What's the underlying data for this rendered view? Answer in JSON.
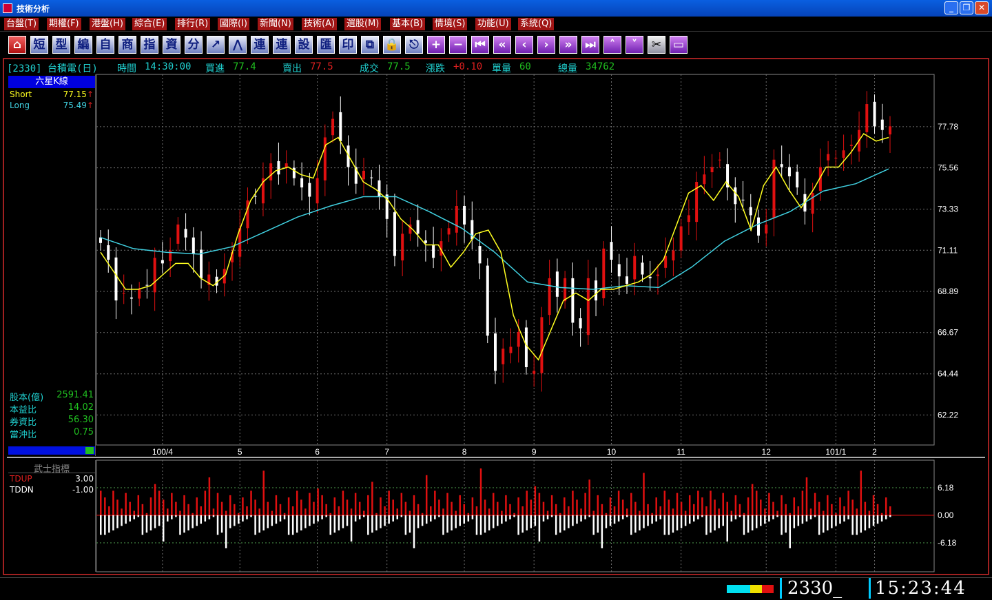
{
  "window": {
    "title": "技術分析",
    "min": "_",
    "restore": "❐",
    "close": "✕"
  },
  "menu": [
    "台盤(T)",
    "期權(F)",
    "港盤(H)",
    "綜合(E)",
    "排行(R)",
    "國際(I)",
    "新聞(N)",
    "技術(A)",
    "選股(M)",
    "基本(B)",
    "情境(S)",
    "功能(U)",
    "系統(Q)"
  ],
  "toolbar": [
    {
      "icon": "home-icon",
      "glyph": "⌂",
      "style": "red"
    },
    {
      "icon": "short-icon",
      "glyph": "短"
    },
    {
      "icon": "type-icon",
      "glyph": "型"
    },
    {
      "icon": "edit-icon",
      "glyph": "編"
    },
    {
      "icon": "custom-icon",
      "glyph": "自"
    },
    {
      "icon": "commodity-icon",
      "glyph": "商"
    },
    {
      "icon": "indicator-icon",
      "glyph": "指"
    },
    {
      "icon": "data-icon",
      "glyph": "資"
    },
    {
      "icon": "minute-icon",
      "glyph": "分"
    },
    {
      "icon": "draw-line-icon",
      "glyph": "↗"
    },
    {
      "icon": "chart-type-icon",
      "glyph": "⋀"
    },
    {
      "icon": "link1-icon",
      "glyph": "連"
    },
    {
      "icon": "link2-icon",
      "glyph": "連"
    },
    {
      "icon": "settings-icon",
      "glyph": "設"
    },
    {
      "icon": "export-icon",
      "glyph": "匯"
    },
    {
      "icon": "print-icon",
      "glyph": "印"
    },
    {
      "icon": "copy-icon",
      "glyph": "⧉"
    },
    {
      "icon": "lock-icon",
      "glyph": "🔒"
    },
    {
      "icon": "esc-icon",
      "glyph": "⎋"
    },
    {
      "icon": "zoom-in-icon",
      "glyph": "+",
      "style": "purple"
    },
    {
      "icon": "zoom-out-icon",
      "glyph": "−",
      "style": "purple"
    },
    {
      "icon": "first-icon",
      "glyph": "⏮",
      "style": "purple"
    },
    {
      "icon": "fast-back-icon",
      "glyph": "«",
      "style": "purple"
    },
    {
      "icon": "back-icon",
      "glyph": "‹",
      "style": "purple"
    },
    {
      "icon": "forward-icon",
      "glyph": "›",
      "style": "purple"
    },
    {
      "icon": "fast-forward-icon",
      "glyph": "»",
      "style": "purple"
    },
    {
      "icon": "last-icon",
      "glyph": "⏭",
      "style": "purple"
    },
    {
      "icon": "up-icon",
      "glyph": "˄",
      "style": "purple"
    },
    {
      "icon": "down-icon",
      "glyph": "˅",
      "style": "purple"
    },
    {
      "icon": "tools-icon",
      "glyph": "✂",
      "style": "gray"
    },
    {
      "icon": "window-icon",
      "glyph": "▭",
      "style": "purple"
    }
  ],
  "quote": {
    "code": "[2330] 台積電(日)",
    "time_label": "時間",
    "time": "14:30:00",
    "bid_label": "買進",
    "bid": "77.4",
    "ask_label": "賣出",
    "ask": "77.5",
    "last_label": "成交",
    "last": "77.5",
    "chg_label": "漲跌",
    "chg": "+0.10",
    "vol_label": "單量",
    "vol": "60",
    "total_label": "總量",
    "total": "34762"
  },
  "panel": {
    "title": "六星K線",
    "short_label": "Short",
    "short": "77.15",
    "long_label": "Long",
    "long": "75.49",
    "stats": [
      {
        "label": "股本(億)",
        "value": "2591.41"
      },
      {
        "label": "本益比",
        "value": "14.02"
      },
      {
        "label": "券資比",
        "value": "56.30"
      },
      {
        "label": "當沖比",
        "value": "0.75"
      }
    ]
  },
  "indicator": {
    "title": "武士指標",
    "tdup_label": "TDUP",
    "tdup": "3.00",
    "tddn_label": "TDDN",
    "tddn": "-1.00"
  },
  "status": {
    "code": "2330_",
    "time": "15:23:44"
  },
  "colors": {
    "up": "#e01010",
    "down": "#ffffff",
    "flat": "#888888",
    "short": "#ffff20",
    "long": "#40d0e0",
    "grid": "#707070"
  },
  "chart_data": [
    {
      "type": "candlestick",
      "title": "六星K線",
      "y_ticks": [
        77.78,
        75.56,
        73.33,
        71.11,
        68.89,
        66.67,
        64.44,
        62.22
      ],
      "ylim": [
        60.6,
        80.6
      ],
      "x_labels": [
        "100/4",
        "5",
        "6",
        "7",
        "8",
        "9",
        "10",
        "11",
        "12",
        "101/1",
        "2"
      ],
      "closes": [
        71.5,
        70.6,
        68.4,
        68.8,
        68.5,
        69.0,
        69.2,
        70.7,
        70.4,
        71.1,
        72.5,
        71.8,
        70.9,
        69.6,
        69.8,
        69.2,
        70.1,
        71.0,
        72.3,
        73.8,
        74.0,
        75.0,
        75.8,
        75.2,
        75.8,
        75.0,
        74.5,
        74.0,
        75.0,
        77.2,
        78.2,
        77.0,
        75.6,
        74.7,
        75.4,
        75.0,
        74.0,
        72.8,
        70.8,
        72.0,
        72.5,
        72.0,
        71.5,
        70.7,
        71.6,
        72.3,
        73.5,
        72.5,
        71.7,
        70.4,
        66.5,
        64.6,
        65.8,
        65.9,
        66.7,
        64.8,
        64.6,
        67.5,
        69.6,
        68.6,
        69.6,
        67.2,
        66.9,
        69.6,
        68.4,
        71.2,
        70.6,
        69.7,
        69.3,
        70.8,
        69.8,
        69.6,
        69.8,
        70.8,
        71.1,
        72.4,
        73.0,
        74.8,
        75.2,
        75.6,
        76.0,
        74.5,
        73.6,
        73.8,
        73.0,
        71.9,
        72.5,
        76.0,
        75.6,
        75.1,
        74.5,
        73.2,
        74.2,
        75.6,
        76.3,
        76.1,
        76.5,
        76.8,
        77.6,
        79.0,
        77.8,
        77.6,
        77.8
      ],
      "short_ma": [
        71.0,
        70.0,
        69.0,
        69.0,
        69.2,
        69.8,
        70.4,
        70.4,
        69.6,
        69.2,
        69.8,
        72.0,
        73.8,
        74.8,
        75.4,
        75.6,
        75.2,
        75.0,
        76.8,
        77.2,
        76.0,
        74.8,
        74.4,
        73.8,
        72.8,
        72.2,
        71.4,
        71.4,
        70.2,
        71.0,
        72.0,
        72.2,
        71.0,
        67.6,
        66.0,
        65.2,
        66.8,
        68.4,
        68.8,
        68.4,
        69.0,
        69.0,
        69.2,
        69.4,
        69.8,
        70.6,
        72.4,
        74.2,
        74.6,
        73.8,
        74.8,
        74.0,
        72.2,
        74.6,
        75.6,
        74.4,
        73.4,
        74.4,
        75.6,
        75.6,
        76.4,
        77.4,
        77.0,
        77.2
      ],
      "long_ma": [
        71.8,
        71.2,
        71.0,
        70.9,
        71.3,
        72.1,
        72.9,
        73.5,
        74.0,
        74.0,
        73.2,
        72.3,
        71.0,
        69.4,
        69.1,
        69.0,
        69.2,
        69.1,
        70.2,
        71.6,
        72.5,
        73.2,
        74.3,
        74.7,
        75.5
      ]
    },
    {
      "type": "bar",
      "title": "武士指標",
      "y_ticks": [
        6.18,
        0.0,
        -6.18
      ],
      "series": [
        {
          "name": "TDUP",
          "color": "#e01010"
        },
        {
          "name": "TDDN",
          "color": "#ffffff"
        }
      ]
    }
  ]
}
